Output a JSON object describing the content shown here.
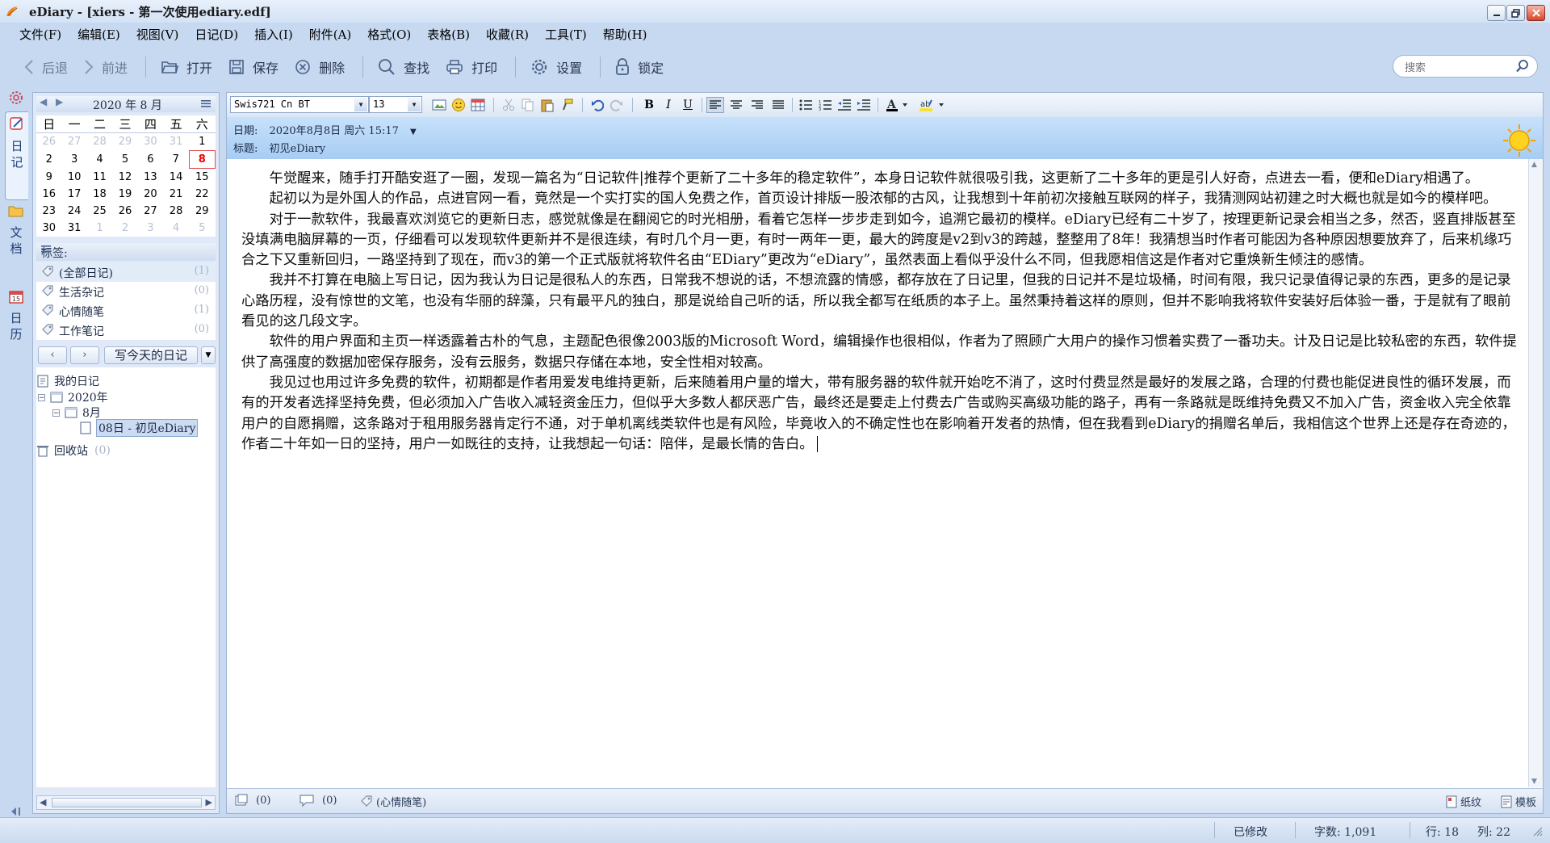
{
  "window": {
    "title": "eDiary - [xiers - 第一次使用ediary.edf]",
    "controls": [
      "minimize",
      "restore",
      "close"
    ]
  },
  "menu": [
    "文件(F)",
    "编辑(E)",
    "视图(V)",
    "日记(D)",
    "插入(I)",
    "附件(A)",
    "格式(O)",
    "表格(B)",
    "收藏(R)",
    "工具(T)",
    "帮助(H)"
  ],
  "toolbar": {
    "back": "后退",
    "forward": "前进",
    "open": "打开",
    "save": "保存",
    "delete": "删除",
    "find": "查找",
    "print": "打印",
    "settings": "设置",
    "lock": "锁定",
    "search_placeholder": "搜索"
  },
  "sidebar_tabs": [
    "日记",
    "文档",
    "日历"
  ],
  "calendar": {
    "title": "2020 年 8 月",
    "weekdays": [
      "日",
      "一",
      "二",
      "三",
      "四",
      "五",
      "六"
    ],
    "weeks": [
      [
        "26",
        "27",
        "28",
        "29",
        "30",
        "31",
        "1"
      ],
      [
        "2",
        "3",
        "4",
        "5",
        "6",
        "7",
        "8"
      ],
      [
        "9",
        "10",
        "11",
        "12",
        "13",
        "14",
        "15"
      ],
      [
        "16",
        "17",
        "18",
        "19",
        "20",
        "21",
        "22"
      ],
      [
        "23",
        "24",
        "25",
        "26",
        "27",
        "28",
        "29"
      ],
      [
        "30",
        "31",
        "1",
        "2",
        "3",
        "4",
        "5"
      ]
    ],
    "today": "8"
  },
  "tags": {
    "header": "标签:",
    "items": [
      {
        "name": "(全部日记)",
        "count": "(1)"
      },
      {
        "name": "生活杂记",
        "count": "(0)"
      },
      {
        "name": "心情随笔",
        "count": "(1)"
      },
      {
        "name": "工作笔记",
        "count": "(0)"
      }
    ]
  },
  "nav": {
    "write_today": "写今天的日记"
  },
  "tree": {
    "root": "我的日记",
    "year": "2020年",
    "month": "8月",
    "entry": "08日 - 初见eDiary",
    "recycle": "回收站",
    "recycle_count": "(0)"
  },
  "format_bar": {
    "font": "Swis721 Cn BT",
    "size": "13"
  },
  "entry": {
    "date_label": "日期:",
    "date_value": "2020年8月8日 周六 15:17",
    "title_label": "标题:",
    "title_value": "初见eDiary",
    "paragraphs": [
      "午觉醒来，随手打开酷安逛了一圈，发现一篇名为“日记软件|推荐个更新了二十多年的稳定软件”，本身日记软件就很吸引我，这更新了二十多年的更是引人好奇，点进去一看，便和eDiary相遇了。",
      "起初以为是外国人的作品，点进官网一看，竟然是一个实打实的国人免费之作，首页设计排版一股浓郁的古风，让我想到十年前初次接触互联网的样子，我猜测网站初建之时大概也就是如今的模样吧。",
      "对于一款软件，我最喜欢浏览它的更新日志，感觉就像是在翻阅它的时光相册，看着它怎样一步步走到如今，追溯它最初的模样。eDiary已经有二十岁了，按理更新记录会相当之多，然否，竖直排版甚至没填满电脑屏幕的一页，仔细看可以发现软件更新并不是很连续，有时几个月一更，有时一两年一更，最大的跨度是v2到v3的跨越，整整用了8年！我猜想当时作者可能因为各种原因想要放弃了，后来机缘巧合之下又重新回归，一路坚持到了现在，而v3的第一个正式版就将软件名由“EDiary”更改为“eDiary”，虽然表面上看似乎没什么不同，但我愿相信这是作者对它重焕新生倾注的感情。",
      "我并不打算在电脑上写日记，因为我认为日记是很私人的东西，日常我不想说的话，不想流露的情感，都存放在了日记里，但我的日记并不是垃圾桶，时间有限，我只记录值得记录的东西，更多的是记录心路历程，没有惊世的文笔，也没有华丽的辞藻，只有最平凡的独白，那是说给自己听的话，所以我全都写在纸质的本子上。虽然秉持着这样的原则，但并不影响我将软件安装好后体验一番，于是就有了眼前看见的这几段文字。",
      "软件的用户界面和主页一样透露着古朴的气息，主题配色很像2003版的Microsoft Word，编辑操作也很相似，作者为了照顾广大用户的操作习惯着实费了一番功夫。计及日记是比较私密的东西，软件提供了高强度的数据加密保存服务，没有云服务，数据只存储在本地，安全性相对较高。",
      "我见过也用过许多免费的软件，初期都是作者用爱发电维持更新，后来随着用户量的增大，带有服务器的软件就开始吃不消了，这时付费显然是最好的发展之路，合理的付费也能促进良性的循环发展，而有的开发者选择坚持免费，但必须加入广告收入减轻资金压力，但似乎大多数人都厌恶广告，最终还是要走上付费去广告或购买高级功能的路子，再有一条路就是既维持免费又不加入广告，资金收入完全依靠用户的自愿捐赠，这条路对于租用服务器肯定行不通，对于单机离线类软件也是有风险，毕竟收入的不确定性也在影响着开发者的热情，但在我看到eDiary的捐赠名单后，我相信这个世界上还是存在奇迹的，作者二十年如一日的坚持，用户一如既往的支持，让我想起一句话：陪伴，是最长情的告白。"
    ]
  },
  "editor_bottom": {
    "attachments": "(0)",
    "comments": "(0)",
    "tag": "(心情随笔)",
    "paper": "纸纹",
    "template": "模板"
  },
  "status": {
    "modified": "已修改",
    "chars": "字数: 1,091",
    "row": "行: 18",
    "col": "列: 22"
  }
}
